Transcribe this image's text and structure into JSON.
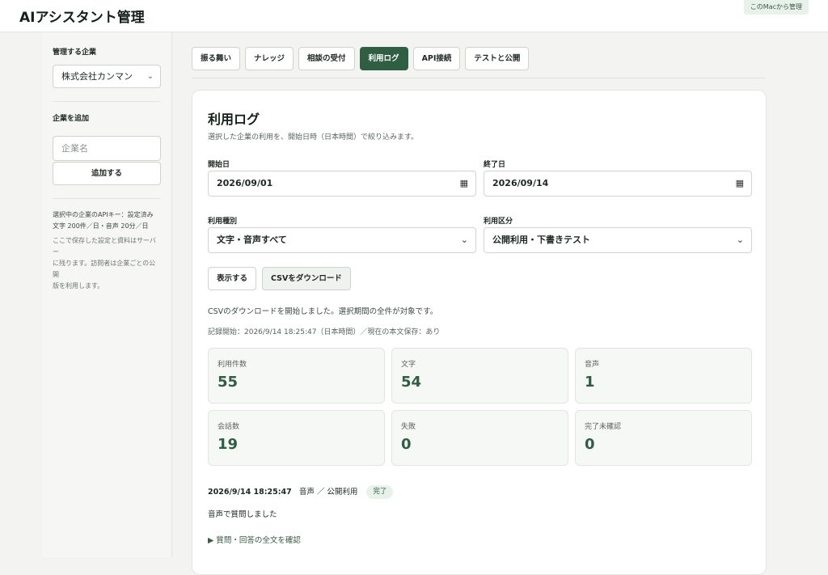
{
  "header": {
    "title": "AIアシスタント管理",
    "badge": "このMacから管理"
  },
  "sidebar": {
    "company_label": "管理する企業",
    "company_selected": "株式会社カンマン",
    "add_label": "企業を追加",
    "add_placeholder": "企業名",
    "add_button": "追加する",
    "note_api_1": "選択中の企業のAPIキー：設定済み",
    "note_api_2": "文字 200件／日・音声 20分／日",
    "note_save_1": "ここで保存した設定と資料はサーバー",
    "note_save_2": "に残ります。訪問者は企業ごとの公開",
    "note_save_3": "版を利用します。"
  },
  "tabs": [
    {
      "label": "振る舞い"
    },
    {
      "label": "ナレッジ"
    },
    {
      "label": "相談の受付"
    },
    {
      "label": "利用ログ"
    },
    {
      "label": "API接続"
    },
    {
      "label": "テストと公開"
    }
  ],
  "log": {
    "title": "利用ログ",
    "description": "選択した企業の利用を、開始日時（日本時間）で絞り込みます。",
    "start_label": "開始日",
    "start_value": "2026/09/01",
    "end_label": "終了日",
    "end_value": "2026/09/14",
    "type_label": "利用種別",
    "type_value": "文字・音声すべて",
    "category_label": "利用区分",
    "category_value": "公開利用・下書きテスト",
    "show_button": "表示する",
    "csv_button": "CSVをダウンロード",
    "csv_message": "CSVのダウンロードを開始しました。選択期間の全件が対象です。",
    "record_info": "記録開始：2026/9/14 18:25:47（日本時間）／現在の本文保存：あり",
    "stats": [
      {
        "label": "利用件数",
        "value": "55"
      },
      {
        "label": "文字",
        "value": "54"
      },
      {
        "label": "音声",
        "value": "1"
      },
      {
        "label": "会話数",
        "value": "19"
      },
      {
        "label": "失敗",
        "value": "0"
      },
      {
        "label": "完了未確認",
        "value": "0"
      }
    ],
    "entry": {
      "time": "2026/9/14 18:25:47",
      "meta": "音声 ／ 公開利用",
      "status": "完了",
      "text": "音声で質問しました",
      "detail": "▶ 質問・回答の全文を確認"
    }
  }
}
